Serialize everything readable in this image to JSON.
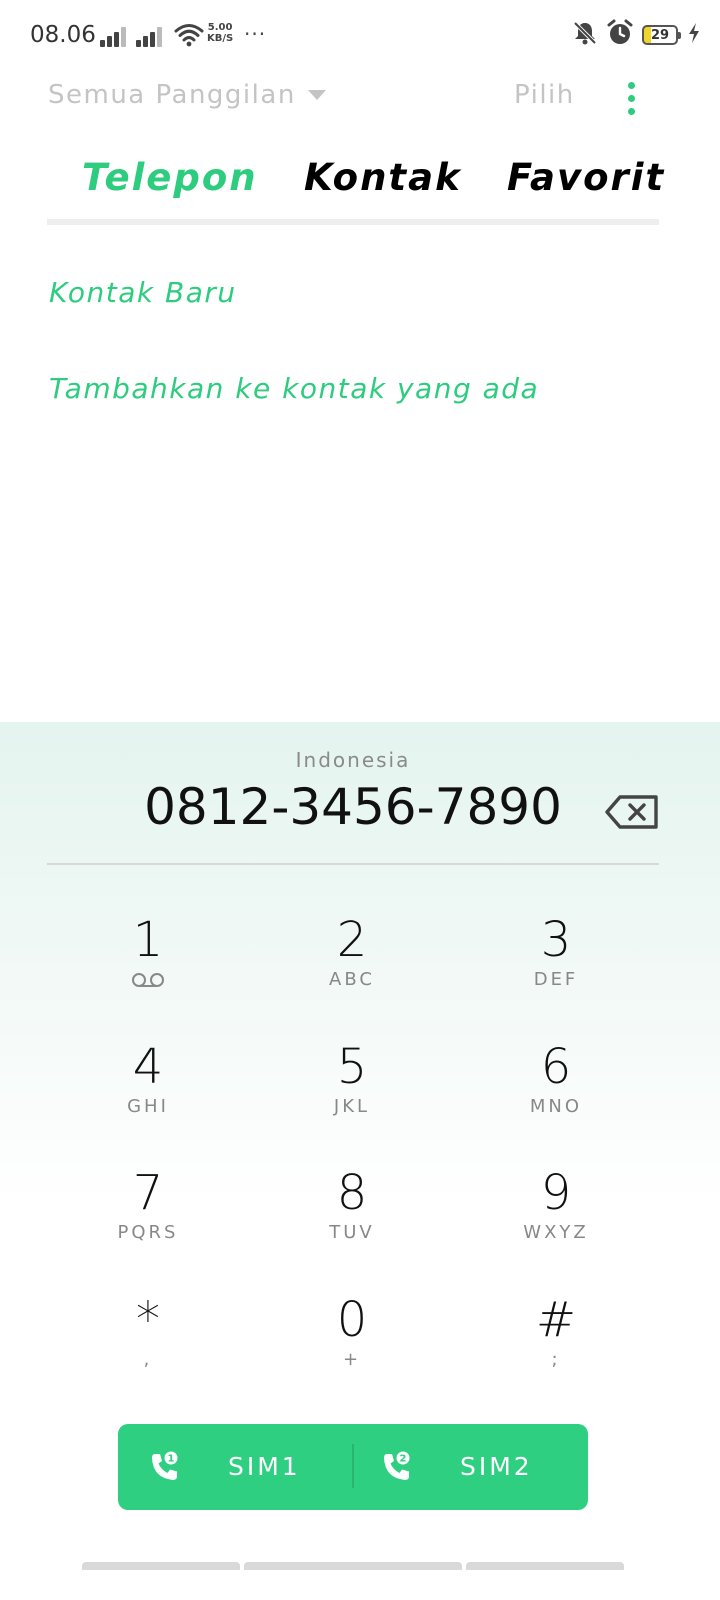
{
  "status_bar": {
    "time": "08.06",
    "net_speed_value": "5.00",
    "net_speed_unit": "KB/S",
    "more": "···",
    "battery_level": "29",
    "icons": [
      "signal-icon",
      "signal-icon",
      "wifi-icon",
      "notifications-off-icon",
      "alarm-icon",
      "battery-icon",
      "charging-icon"
    ]
  },
  "top_bar": {
    "filter_label": "Semua Panggilan",
    "select_label": "Pilih"
  },
  "tabs": [
    {
      "label": "Telepon",
      "active": true
    },
    {
      "label": "Kontak",
      "active": false
    },
    {
      "label": "Favorit",
      "active": false
    }
  ],
  "options": {
    "new_contact": "Kontak Baru",
    "add_to_existing": "Tambahkan ke kontak yang ada"
  },
  "dialer": {
    "region": "Indonesia",
    "number": "0812-3456-7890",
    "keys": [
      {
        "digit": "1",
        "letters": ""
      },
      {
        "digit": "2",
        "letters": "ABC"
      },
      {
        "digit": "3",
        "letters": "DEF"
      },
      {
        "digit": "4",
        "letters": "GHI"
      },
      {
        "digit": "5",
        "letters": "JKL"
      },
      {
        "digit": "6",
        "letters": "MNO"
      },
      {
        "digit": "7",
        "letters": "PQRS"
      },
      {
        "digit": "8",
        "letters": "TUV"
      },
      {
        "digit": "9",
        "letters": "WXYZ"
      },
      {
        "digit": "*",
        "letters": ","
      },
      {
        "digit": "0",
        "letters": "+"
      },
      {
        "digit": "#",
        "letters": ";"
      }
    ]
  },
  "call_buttons": {
    "sim1": "SIM1",
    "sim2": "SIM2"
  },
  "colors": {
    "accent": "#2ecc7f",
    "call_bar": "#2ecf80"
  }
}
